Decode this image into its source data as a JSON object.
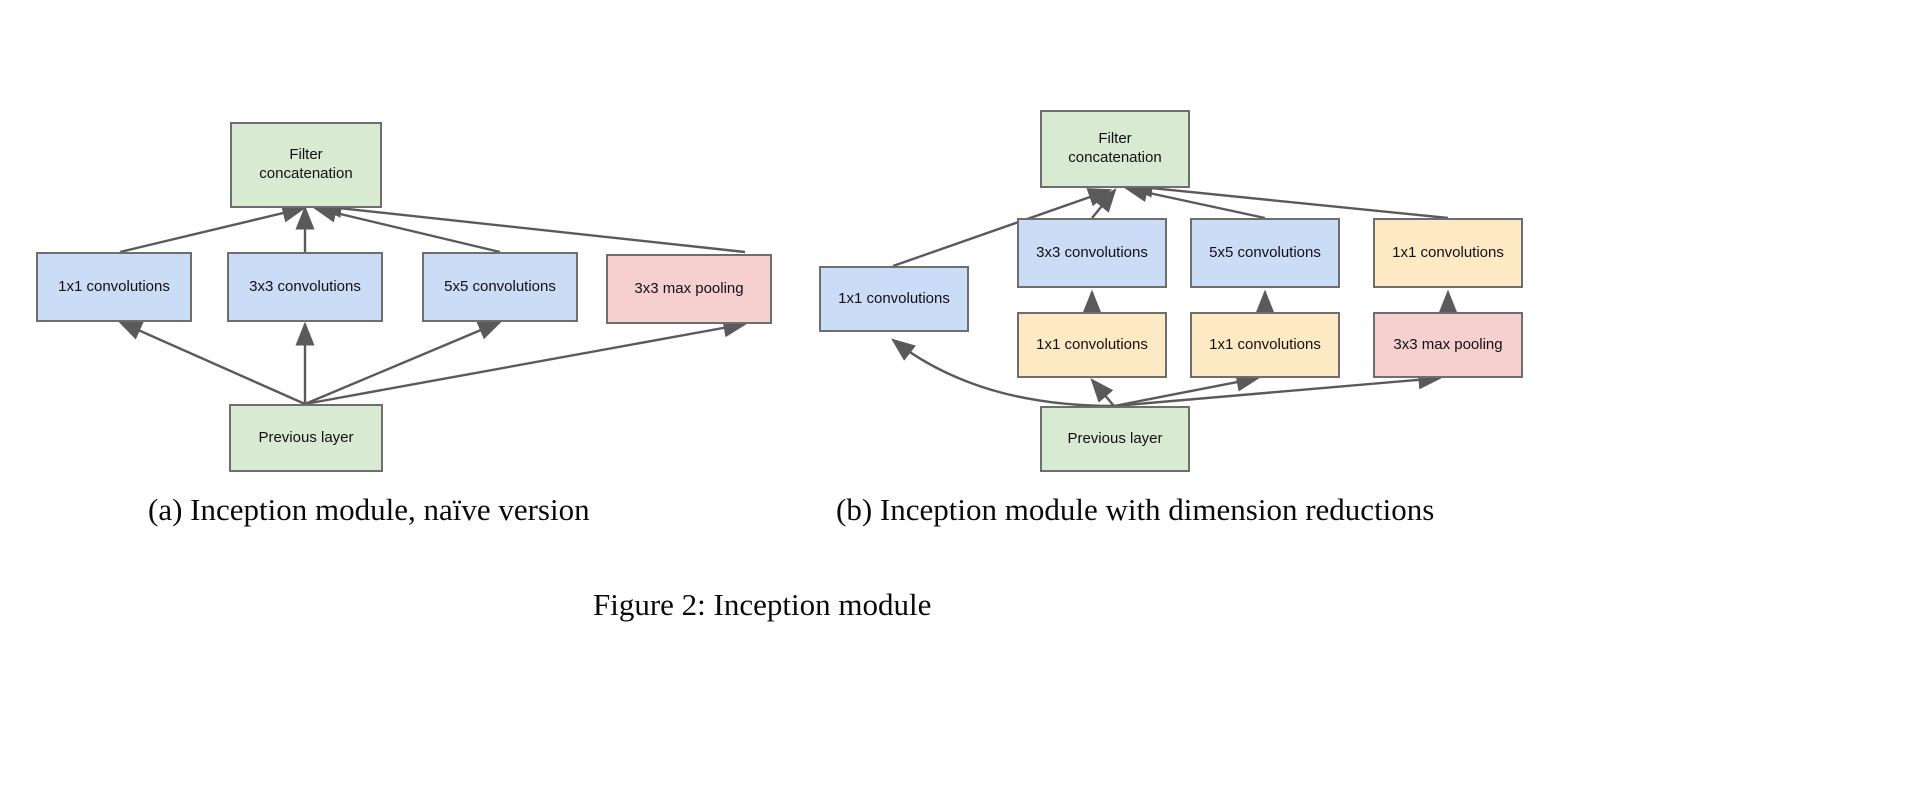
{
  "figure": {
    "caption": "Figure 2: Inception module",
    "panels": [
      {
        "id": "a",
        "caption": "(a)  Inception module, naïve version",
        "nodes": {
          "filter_concat": "Filter\nconcatenation",
          "conv1x1": "1x1 convolutions",
          "conv3x3": "3x3 convolutions",
          "conv5x5": "5x5 convolutions",
          "maxpool3x3": "3x3 max pooling",
          "previous_layer": "Previous layer"
        }
      },
      {
        "id": "b",
        "caption": "(b)  Inception module with dimension reductions",
        "nodes": {
          "filter_concat": "Filter\nconcatenation",
          "conv1x1_left": "1x1 convolutions",
          "conv3x3": "3x3 convolutions",
          "conv5x5": "5x5 convolutions",
          "conv1x1_pool": "1x1 convolutions",
          "reduce1x1_a": "1x1 convolutions",
          "reduce1x1_b": "1x1 convolutions",
          "maxpool3x3": "3x3 max pooling",
          "previous_layer": "Previous layer"
        }
      }
    ]
  },
  "colors": {
    "green_fill": "#d8ead1",
    "blue_fill": "#cbdcf7",
    "yellow_fill": "#fdeac4",
    "red_fill": "#f6cfcf",
    "stroke": "#6e6e6e",
    "arrow": "#5a5a5a",
    "text": "#111111",
    "background": "#ffffff"
  }
}
